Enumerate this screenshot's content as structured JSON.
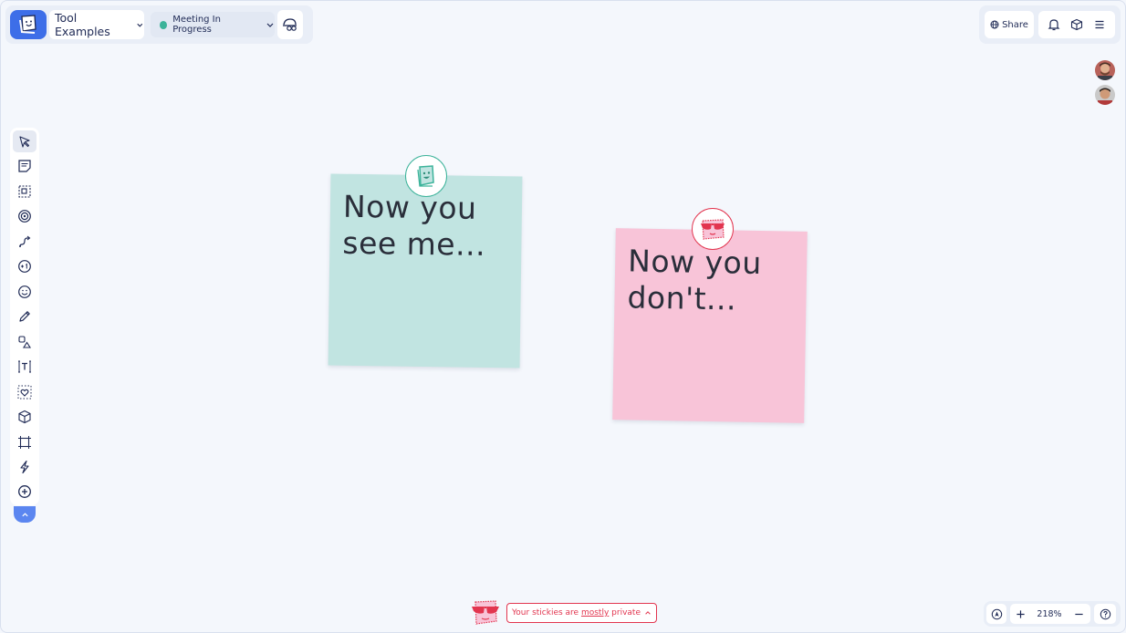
{
  "header": {
    "board_name": "Tool Examples",
    "status": "Meeting In Progress",
    "share_label": "Share"
  },
  "colors": {
    "accent": "#3d6ee8",
    "status_green": "#3cb39a",
    "sticky_teal": "#c1e4e1",
    "sticky_pink": "#f8c4d8",
    "private_red": "#e2354f"
  },
  "toolbar": {
    "tools": [
      {
        "name": "select-tool",
        "icon": "cursor-icon"
      },
      {
        "name": "sticky-note-tool",
        "icon": "sticky-note-icon"
      },
      {
        "name": "area-tool",
        "icon": "area-select-icon"
      },
      {
        "name": "stamp-tool",
        "icon": "stamp-icon"
      },
      {
        "name": "connector-tool",
        "icon": "connector-icon"
      },
      {
        "name": "vote-tool",
        "icon": "plus-one-icon"
      },
      {
        "name": "emoji-tool",
        "icon": "smiley-icon"
      },
      {
        "name": "pen-tool",
        "icon": "pencil-icon"
      },
      {
        "name": "shapes-tool",
        "icon": "shapes-icon"
      },
      {
        "name": "text-tool",
        "icon": "text-icon"
      },
      {
        "name": "reaction-area-tool",
        "icon": "heart-frame-icon"
      },
      {
        "name": "templates-tool",
        "icon": "cube-icon"
      },
      {
        "name": "frame-tool",
        "icon": "frame-icon"
      },
      {
        "name": "integrations-tool",
        "icon": "lightning-icon"
      },
      {
        "name": "more-tools",
        "icon": "plus-circle-icon"
      }
    ]
  },
  "stickies": [
    {
      "text": "Now you\nsee me...",
      "color": "#c1e4e1"
    },
    {
      "text": "Now you\ndon't...",
      "color": "#f8c4d8"
    }
  ],
  "privacy": {
    "prefix": "Your stickies are ",
    "emphasis": "mostly",
    "suffix": " private"
  },
  "zoom": {
    "level": "218%"
  }
}
